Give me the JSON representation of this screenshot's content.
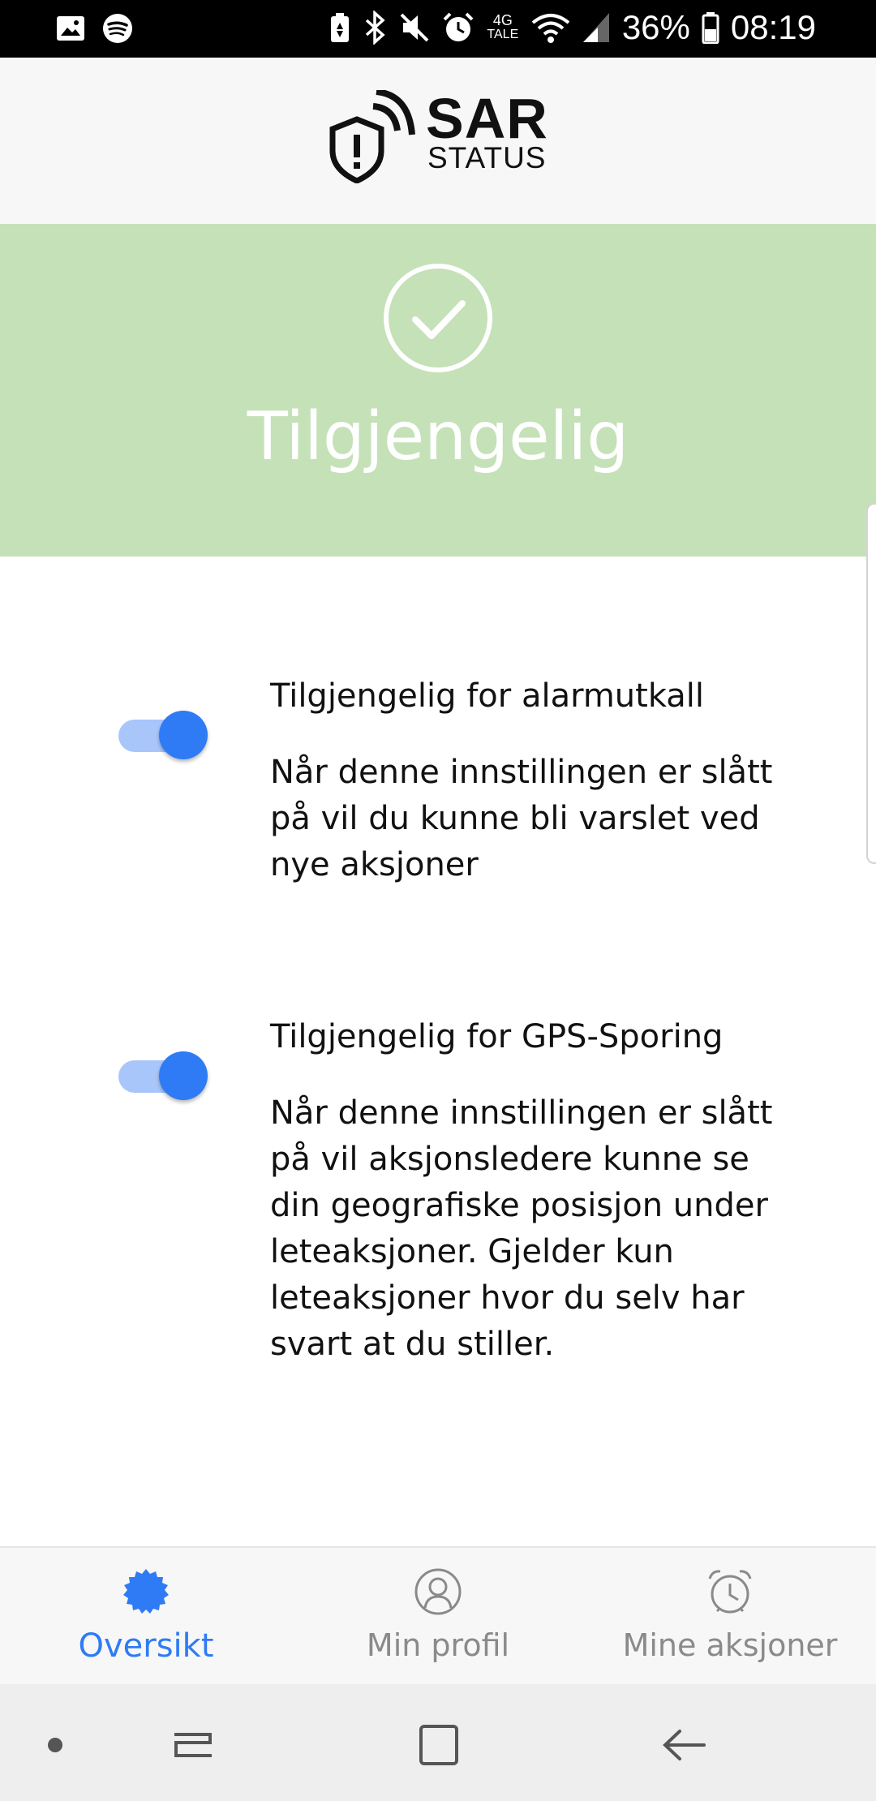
{
  "status_bar": {
    "battery_percent": "36%",
    "time": "08:19",
    "network_top": "4G",
    "network_bottom": "TALE",
    "icons": [
      "gallery-icon",
      "spotify-icon",
      "battery-saver-icon",
      "bluetooth-icon",
      "mute-icon",
      "alarm-icon",
      "wifi-icon",
      "signal-icon",
      "battery-icon"
    ]
  },
  "app": {
    "logo_title": "SAR",
    "logo_subtitle": "STATUS"
  },
  "banner": {
    "title": "Tilgjengelig",
    "color": "#c5e1b7",
    "icon": "checkmark-circle-icon"
  },
  "settings": [
    {
      "title": "Tilgjengelig for alarmutkall",
      "description": "Når denne innstillingen er slått på vil du kunne bli varslet ved nye aksjoner",
      "enabled": true
    },
    {
      "title": "Tilgjengelig for GPS-Sporing",
      "description": "Når denne innstillingen er slått på vil aksjonsledere kunne se din geografiske posisjon under leteaksjoner. Gjelder kun leteaksjoner hvor du selv har svart at du stiller.",
      "enabled": true
    }
  ],
  "bottom_nav": {
    "items": [
      {
        "label": "Oversikt",
        "icon": "overview-badge-icon",
        "active": true
      },
      {
        "label": "Min profil",
        "icon": "profile-icon",
        "active": false
      },
      {
        "label": "Mine aksjoner",
        "icon": "alarm-clock-icon",
        "active": false
      }
    ],
    "accent_color": "#2f7bf5"
  },
  "system_nav": {
    "buttons": [
      "dot-button",
      "recents-button",
      "home-button",
      "back-button"
    ]
  }
}
